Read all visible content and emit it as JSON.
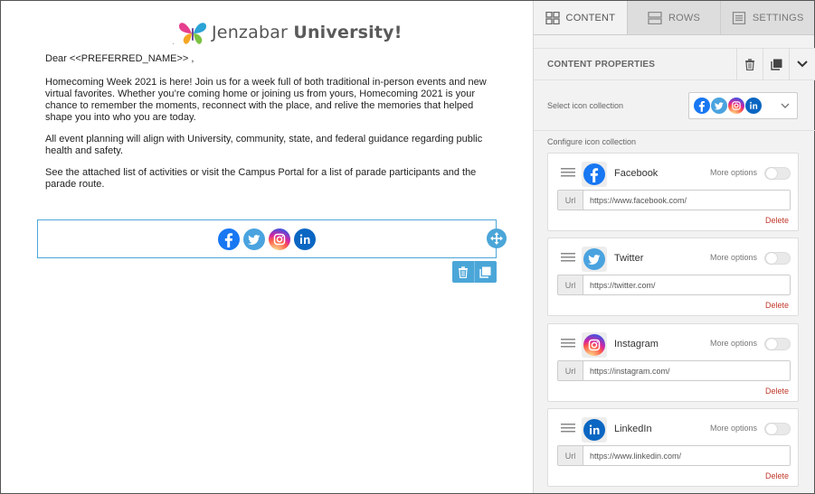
{
  "email": {
    "logo_text_a": "Jenzabar",
    "logo_text_b": "University!",
    "greeting": "Dear <<PREFERRED_NAME>> ,",
    "paragraphs": [
      "Homecoming Week 2021 is here! Join us for a week full of both traditional in-person events and new virtual favorites. Whether you’re coming home or joining us from yours, Homecoming 2021 is your chance to remember the moments, reconnect with the place, and relive the memories that helped shape you into who you are today.",
      "All event planning will align with University, community, state, and federal guidance regarding public health and safety.",
      "See the attached list of activities or visit the Campus Portal for a list of parade participants and the parade route."
    ]
  },
  "tabs": [
    {
      "label": "CONTENT",
      "active": true,
      "icon": "grid-icon"
    },
    {
      "label": "ROWS",
      "active": false,
      "icon": "rows-icon"
    },
    {
      "label": "SETTINGS",
      "active": false,
      "icon": "settings-icon"
    }
  ],
  "properties": {
    "title": "CONTENT PROPERTIES",
    "select_label": "Select icon collection",
    "config_label": "Configure icon collection"
  },
  "networks": [
    {
      "name": "Facebook",
      "more_options": "More options",
      "url_label": "Url",
      "url": "https://www.facebook.com/",
      "delete": "Delete",
      "color": "#1877f2",
      "icon": "facebook-icon"
    },
    {
      "name": "Twitter",
      "more_options": "More options",
      "url_label": "Url",
      "url": "https://twitter.com/",
      "delete": "Delete",
      "color": "#4aa3df",
      "icon": "twitter-icon"
    },
    {
      "name": "Instagram",
      "more_options": "More options",
      "url_label": "Url",
      "url": "https://instagram.com/",
      "delete": "Delete",
      "color": "#c13584",
      "icon": "instagram-icon"
    },
    {
      "name": "LinkedIn",
      "more_options": "More options",
      "url_label": "Url",
      "url": "https://www.linkedin.com/",
      "delete": "Delete",
      "color": "#0a66c2",
      "icon": "linkedin-icon"
    }
  ],
  "colors": {
    "accent": "#4ba6d8",
    "delete": "#c0392b"
  }
}
